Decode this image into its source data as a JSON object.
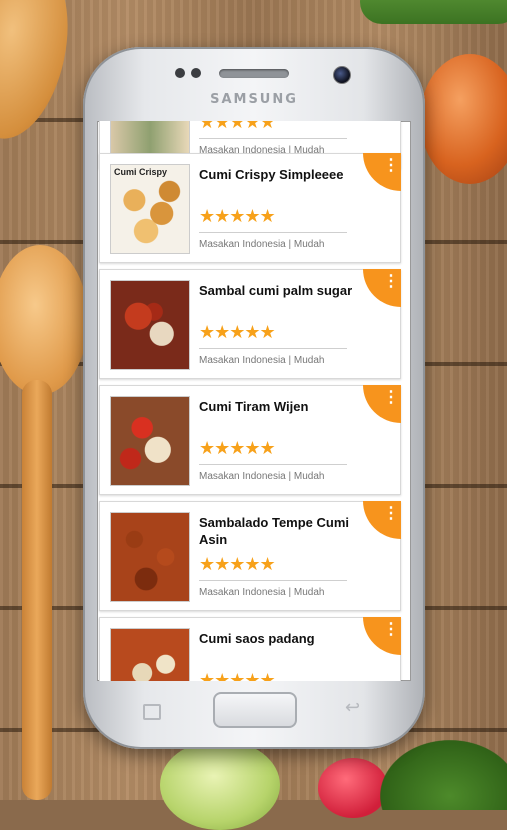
{
  "device": {
    "brand": "SAMSUNG"
  },
  "recipes": [
    {
      "title": "",
      "category": "Masakan Indonesia | Mudah",
      "rating": 4.5,
      "image": "food-top"
    },
    {
      "title": "Cumi Crispy Simpleeee",
      "category": "Masakan Indonesia | Mudah",
      "rating": 4.5,
      "image": "food-crispy",
      "image_caption": "Cumi Crispy"
    },
    {
      "title": "Sambal cumi palm sugar",
      "category": "Masakan Indonesia | Mudah",
      "rating": 4.5,
      "image": "food-sambal"
    },
    {
      "title": "Cumi Tiram Wijen",
      "category": "Masakan Indonesia | Mudah",
      "rating": 4.5,
      "image": "food-tiram"
    },
    {
      "title": "Sambalado Tempe Cumi Asin",
      "category": "Masakan Indonesia | Mudah",
      "rating": 4.5,
      "image": "food-tempe"
    },
    {
      "title": "Cumi saos padang",
      "category": "",
      "rating": 4.5,
      "image": "food-padang"
    }
  ],
  "colors": {
    "accent": "#f7941d",
    "star": "#f7a11a"
  },
  "icons": {
    "more": "vertical-dots-icon",
    "star": "star-icon"
  }
}
